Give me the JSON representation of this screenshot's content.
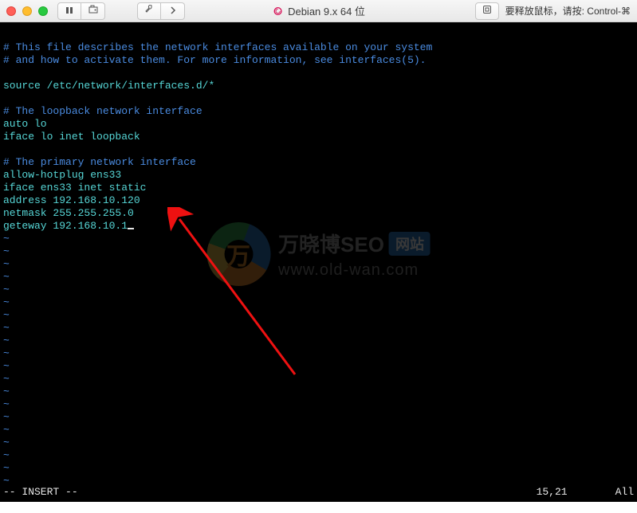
{
  "title": "Debian 9.x 64 位",
  "hint": "要释放鼠标，请按: Control-⌘",
  "editor": {
    "comment1": "# This file describes the network interfaces available on your system",
    "comment2": "# and how to activate them. For more information, see interfaces(5).",
    "source_line": "source /etc/network/interfaces.d/*",
    "loop_comment": "# The loopback network interface",
    "auto_lo": "auto lo",
    "iface_lo": "iface lo inet loopback",
    "primary_comment": "# The primary network interface",
    "allow_hotplug": "allow-hotplug ens33",
    "iface_ens33": "iface ens33 inet static",
    "address": "address 192.168.10.120",
    "netmask": "netmask 255.255.255.0",
    "gateway": "geteway 192.168.10.1",
    "mode": "-- INSERT --",
    "position": "15,21",
    "scroll": "All"
  },
  "watermark": {
    "brand": "万晓博SEO",
    "badge": "网站",
    "url": "www.old-wan.com",
    "logo_char": "万"
  }
}
